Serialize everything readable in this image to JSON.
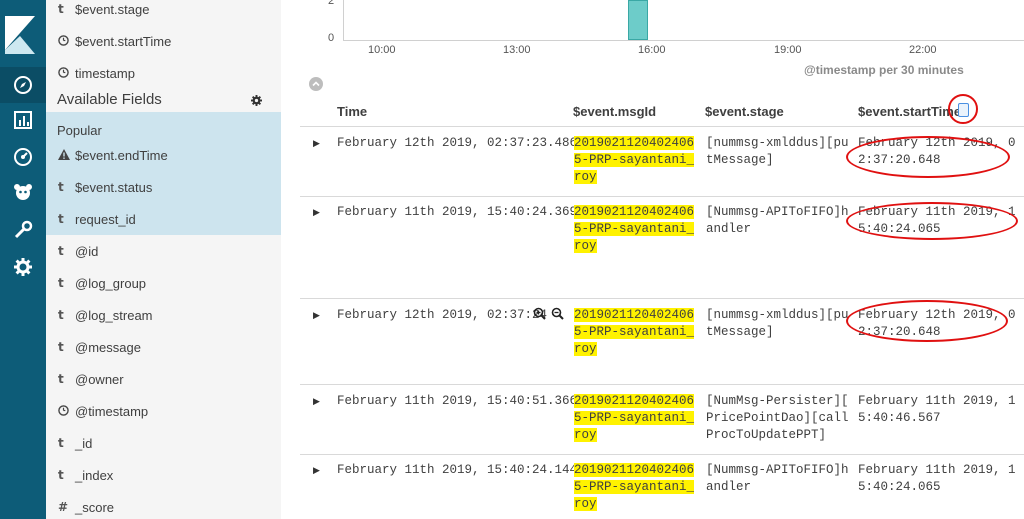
{
  "nav": {
    "icons": [
      "kibana-logo",
      "discover-icon",
      "visualize-icon",
      "dashboard-icon",
      "timelion-icon",
      "devtools-icon",
      "management-icon"
    ]
  },
  "sidebar": {
    "top_fields": [
      {
        "type": "t",
        "name": "$event.stage"
      },
      {
        "type": "clock",
        "name": "$event.startTime"
      },
      {
        "type": "clock",
        "name": "timestamp"
      }
    ],
    "available_title": "Available Fields",
    "popular_label": "Popular",
    "popular_fields": [
      {
        "type": "warn",
        "name": "$event.endTime"
      },
      {
        "type": "t",
        "name": "$event.status"
      },
      {
        "type": "t",
        "name": "request_id"
      }
    ],
    "fields": [
      {
        "type": "t",
        "name": "@id"
      },
      {
        "type": "t",
        "name": "@log_group"
      },
      {
        "type": "t",
        "name": "@log_stream"
      },
      {
        "type": "t",
        "name": "@message"
      },
      {
        "type": "t",
        "name": "@owner"
      },
      {
        "type": "clock",
        "name": "@timestamp"
      },
      {
        "type": "t",
        "name": "_id"
      },
      {
        "type": "t",
        "name": "_index"
      },
      {
        "type": "#",
        "name": "_score"
      }
    ]
  },
  "histogram": {
    "y_ticks": [
      "2",
      "0"
    ],
    "x_ticks": [
      "10:00",
      "13:00",
      "16:00",
      "19:00",
      "22:00"
    ],
    "x_label": "@timestamp per 30 minutes"
  },
  "table": {
    "columns": [
      "Time",
      "$event.msgId",
      "$event.stage",
      "$event.startTime"
    ],
    "rows": [
      {
        "time": "February 12th 2019, 02:37:23.486",
        "msg": [
          "2019021120402406",
          "5-PRP-sayantani_",
          "roy"
        ],
        "stage": [
          "[nummsg-xmlddus][pu",
          "tMessage]"
        ],
        "start": [
          "February 12th 2019, 0",
          "2:37:20.648"
        ]
      },
      {
        "time": "February 11th 2019, 15:40:24.369",
        "msg": [
          "2019021120402406",
          "5-PRP-sayantani_",
          "roy"
        ],
        "stage": [
          "[Nummsg-APIToFIFO]h",
          "andler"
        ],
        "start": [
          "February 11th 2019, 1",
          "5:40:24.065"
        ]
      },
      {
        "time": "February 12th 2019, 02:37:24",
        "msg": [
          "2019021120402406",
          "5-PRP-sayantani_",
          "roy"
        ],
        "stage": [
          "[nummsg-xmlddus][pu",
          "tMessage]"
        ],
        "start": [
          "February 12th 2019, 0",
          "2:37:20.648"
        ]
      },
      {
        "time": "February 11th 2019, 15:40:51.366",
        "msg": [
          "2019021120402406",
          "5-PRP-sayantani_",
          "roy"
        ],
        "stage": [
          "[NumMsg-Persister][",
          "PricePointDao][call",
          "ProcToUpdatePPT]"
        ],
        "start": [
          "February 11th 2019, 1",
          "5:40:46.567"
        ]
      },
      {
        "time": "February 11th 2019, 15:40:24.144",
        "msg": [
          "2019021120402406",
          "5-PRP-sayantani_",
          "roy"
        ],
        "stage": [
          "[Nummsg-APIToFIFO]h",
          "andler"
        ],
        "start": [
          "February 11th 2019, 1",
          "5:40:24.065"
        ]
      }
    ]
  },
  "colors": {
    "nav_bg": "#0d5c78",
    "highlight": "#fff200",
    "annotation": "#e01010",
    "bar": "#6dccc9"
  }
}
